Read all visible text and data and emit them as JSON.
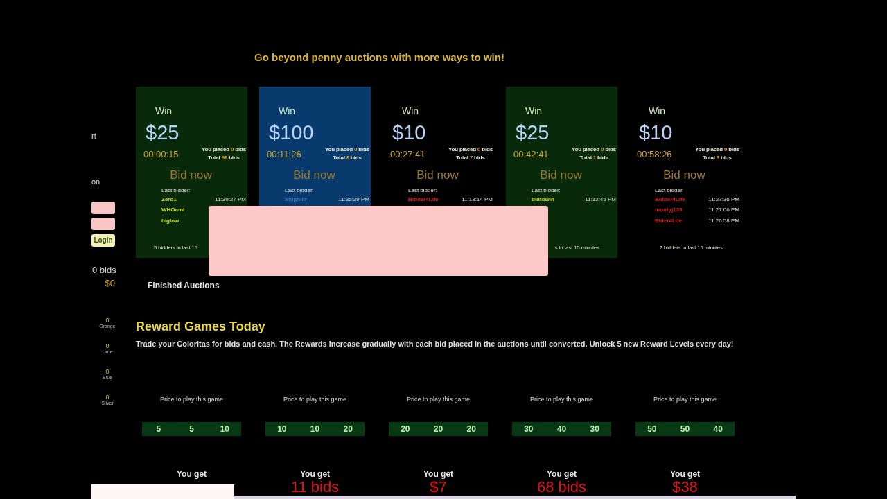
{
  "sidebar": {
    "fragments": [
      "rt",
      "on"
    ],
    "login_button": "Login",
    "bids": "0 bids",
    "cash": "$0",
    "coloritas": [
      {
        "count": "0",
        "label": "Orange"
      },
      {
        "count": "0",
        "label": "Lime"
      },
      {
        "count": "0",
        "label": "Blue"
      },
      {
        "count": "0",
        "label": "Silver"
      }
    ]
  },
  "headline": "Go beyond penny auctions with more ways to win!",
  "auctions": [
    {
      "color": "#082a0a",
      "win_label": "Win",
      "prize": "$25",
      "timer": "00:00:15",
      "placed": [
        "You placed",
        "0",
        "bids"
      ],
      "total": [
        "Total",
        "96",
        "bids"
      ],
      "bid_button": "Bid now",
      "last_bidder_label": "Last bidder:",
      "bidders": [
        {
          "name": "Zero1",
          "color": "#c6e01c",
          "time": "11:39:27 PM"
        },
        {
          "name": "WHOami",
          "color": "#c6e01c"
        },
        {
          "name": "biglow",
          "color": "#c6e01c"
        }
      ],
      "footer": "5 bidders in last 15"
    },
    {
      "color": "#083a6e",
      "win_label": "Win",
      "prize": "$100",
      "timer": "00:11:26",
      "placed": [
        "You placed",
        "0",
        "bids"
      ],
      "total": [
        "Total",
        "8",
        "bids"
      ],
      "bid_button": "Bid now",
      "last_bidder_label": "Last bidder:",
      "bidders": [
        {
          "name": "Sniphillr",
          "color": "#3c78c8",
          "time": "11:35:39 PM"
        }
      ]
    },
    {
      "win_label": "Win",
      "prize": "$10",
      "timer": "00:27:41",
      "placed": [
        "You placed",
        "0",
        "bids"
      ],
      "total": [
        "Total",
        "7",
        "bids"
      ],
      "bid_button": "Bid now",
      "last_bidder_label": "Last bidder:",
      "bidders": [
        {
          "name": "Bidder4Life",
          "color": "#e01c1c",
          "time": "11:13:14 PM"
        }
      ]
    },
    {
      "color": "#082a0a",
      "win_label": "Win",
      "prize": "$25",
      "timer": "00:42:41",
      "placed": [
        "You placed",
        "0",
        "bids"
      ],
      "total": [
        "Total",
        "1",
        "bids"
      ],
      "bid_button": "Bid now",
      "last_bidder_label": "Last bidder:",
      "bidders": [
        {
          "name": "bidtowin",
          "color": "#c6e01c",
          "time": "11:12:45 PM"
        }
      ],
      "footer": "s in last 15 minutes"
    },
    {
      "win_label": "Win",
      "prize": "$10",
      "timer": "00:58:26",
      "placed": [
        "You placed",
        "0",
        "bids"
      ],
      "total": [
        "Total",
        "3",
        "bids"
      ],
      "bid_button": "Bid now",
      "last_bidder_label": "Last bidder:",
      "bidders": [
        {
          "name": "Bidder4Life",
          "color": "#e01c1c",
          "time": "11:27:36 PM"
        },
        {
          "name": "montyj123",
          "color": "#e01c1c",
          "time": "11:27:06 PM"
        },
        {
          "name": "Bider4Life",
          "color": "#e01c1c",
          "time": "11:26:58 PM"
        }
      ],
      "footer": "2 bidders in last 15 minutes"
    }
  ],
  "finished_link": "Finished Auctions",
  "rewards": {
    "title": "Reward Games Today",
    "description": "Trade your Coloritas for bids and cash. The Rewards increase gradually with each bid placed in the auctions until converted. Unlock 5 new Reward Levels every day!",
    "games": [
      {
        "price_label": "Price to play this game",
        "prices": [
          "5",
          "5",
          "10"
        ],
        "you_get_label": "You get"
      },
      {
        "price_label": "Price to play this game",
        "prices": [
          "10",
          "10",
          "20"
        ],
        "you_get_label": "You get",
        "reward": "11 bids"
      },
      {
        "price_label": "Price to play this game",
        "prices": [
          "20",
          "20",
          "20"
        ],
        "you_get_label": "You get",
        "reward": "$7"
      },
      {
        "price_label": "Price to play this game",
        "prices": [
          "30",
          "40",
          "30"
        ],
        "you_get_label": "You get",
        "reward": "68 bids"
      },
      {
        "price_label": "Price to play this game",
        "prices": [
          "50",
          "50",
          "40"
        ],
        "you_get_label": "You get",
        "reward": "$38"
      }
    ]
  }
}
